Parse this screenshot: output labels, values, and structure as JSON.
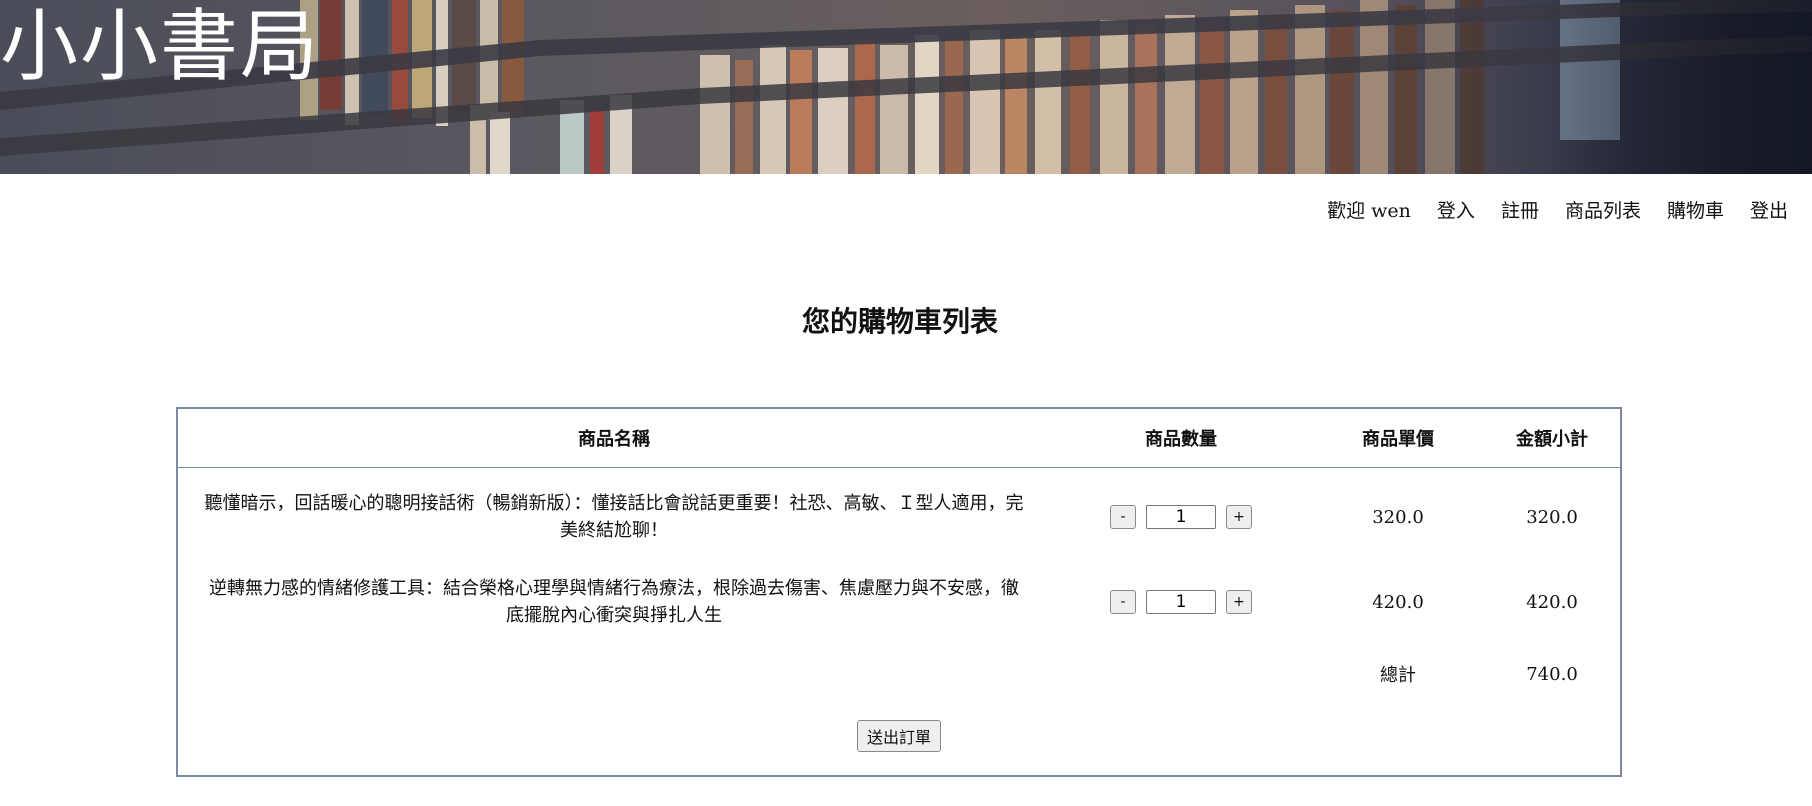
{
  "header": {
    "site_title": "小小書局"
  },
  "nav": {
    "welcome_prefix": "歡迎",
    "username": "wen",
    "items": [
      {
        "label": "登入"
      },
      {
        "label": "註冊"
      },
      {
        "label": "商品列表"
      },
      {
        "label": "購物車"
      },
      {
        "label": "登出"
      }
    ]
  },
  "page": {
    "title": "您的購物車列表"
  },
  "cart": {
    "columns": {
      "name": "商品名稱",
      "quantity": "商品數量",
      "unit_price": "商品單價",
      "subtotal": "金額小計"
    },
    "rows": [
      {
        "name": "聽懂暗示，回話暖心的聰明接話術（暢銷新版）：懂接話比會說話更重要！社恐、高敏、Ｉ型人適用，完美終結尬聊！",
        "quantity": "1",
        "unit_price": "320.0",
        "subtotal": "320.0"
      },
      {
        "name": "逆轉無力感的情緒修護工具：結合榮格心理學與情緒行為療法，根除過去傷害、焦慮壓力與不安感，徹底擺脫內心衝突與掙扎人生",
        "quantity": "1",
        "unit_price": "420.0",
        "subtotal": "420.0"
      }
    ],
    "decrement_label": "-",
    "increment_label": "+",
    "total_label": "總計",
    "total_value": "740.0",
    "submit_label": "送出訂單"
  }
}
